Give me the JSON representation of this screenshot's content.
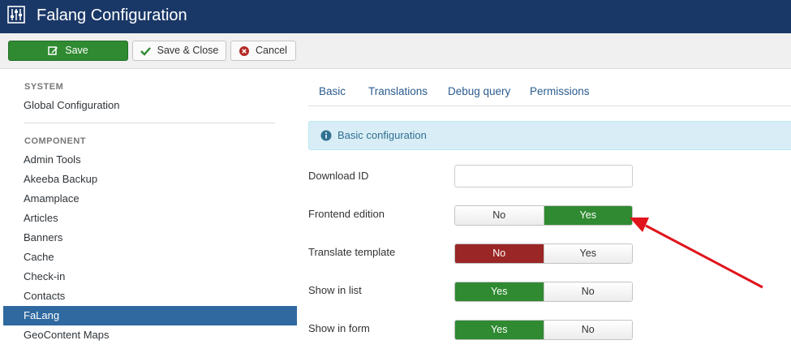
{
  "header": {
    "title": "Falang Configuration",
    "icon": "sliders-icon",
    "background": "#1a3867"
  },
  "toolbar": {
    "save_label": "Save",
    "save_close_label": "Save & Close",
    "cancel_label": "Cancel",
    "save_color": "#2f8a31"
  },
  "sidebar": {
    "system_heading": "SYSTEM",
    "global_config": "Global Configuration",
    "component_heading": "COMPONENT",
    "items": [
      {
        "label": "Admin Tools",
        "active": false
      },
      {
        "label": "Akeeba Backup",
        "active": false
      },
      {
        "label": "Amamplace",
        "active": false
      },
      {
        "label": "Articles",
        "active": false
      },
      {
        "label": "Banners",
        "active": false
      },
      {
        "label": "Cache",
        "active": false
      },
      {
        "label": "Check-in",
        "active": false
      },
      {
        "label": "Contacts",
        "active": false
      },
      {
        "label": "FaLang",
        "active": true
      },
      {
        "label": "GeoContent Maps",
        "active": false
      }
    ],
    "active_color": "#2f69a0"
  },
  "tabs": [
    {
      "label": "Basic"
    },
    {
      "label": "Translations"
    },
    {
      "label": "Debug query"
    },
    {
      "label": "Permissions"
    }
  ],
  "info": {
    "text": "Basic configuration",
    "icon": "info-circle-icon"
  },
  "form": {
    "download_id": {
      "label": "Download ID",
      "value": "",
      "placeholder": ""
    },
    "frontend_edition": {
      "label": "Frontend edition",
      "options": [
        "No",
        "Yes"
      ],
      "selected": "Yes"
    },
    "translate_template": {
      "label": "Translate template",
      "options": [
        "No",
        "Yes"
      ],
      "selected": "No"
    },
    "show_in_list": {
      "label": "Show in list",
      "options": [
        "Yes",
        "No"
      ],
      "selected": "Yes"
    },
    "show_in_form": {
      "label": "Show in form",
      "options": [
        "Yes",
        "No"
      ],
      "selected": "Yes"
    }
  },
  "annotation": {
    "arrow_color": "#e0141c"
  }
}
